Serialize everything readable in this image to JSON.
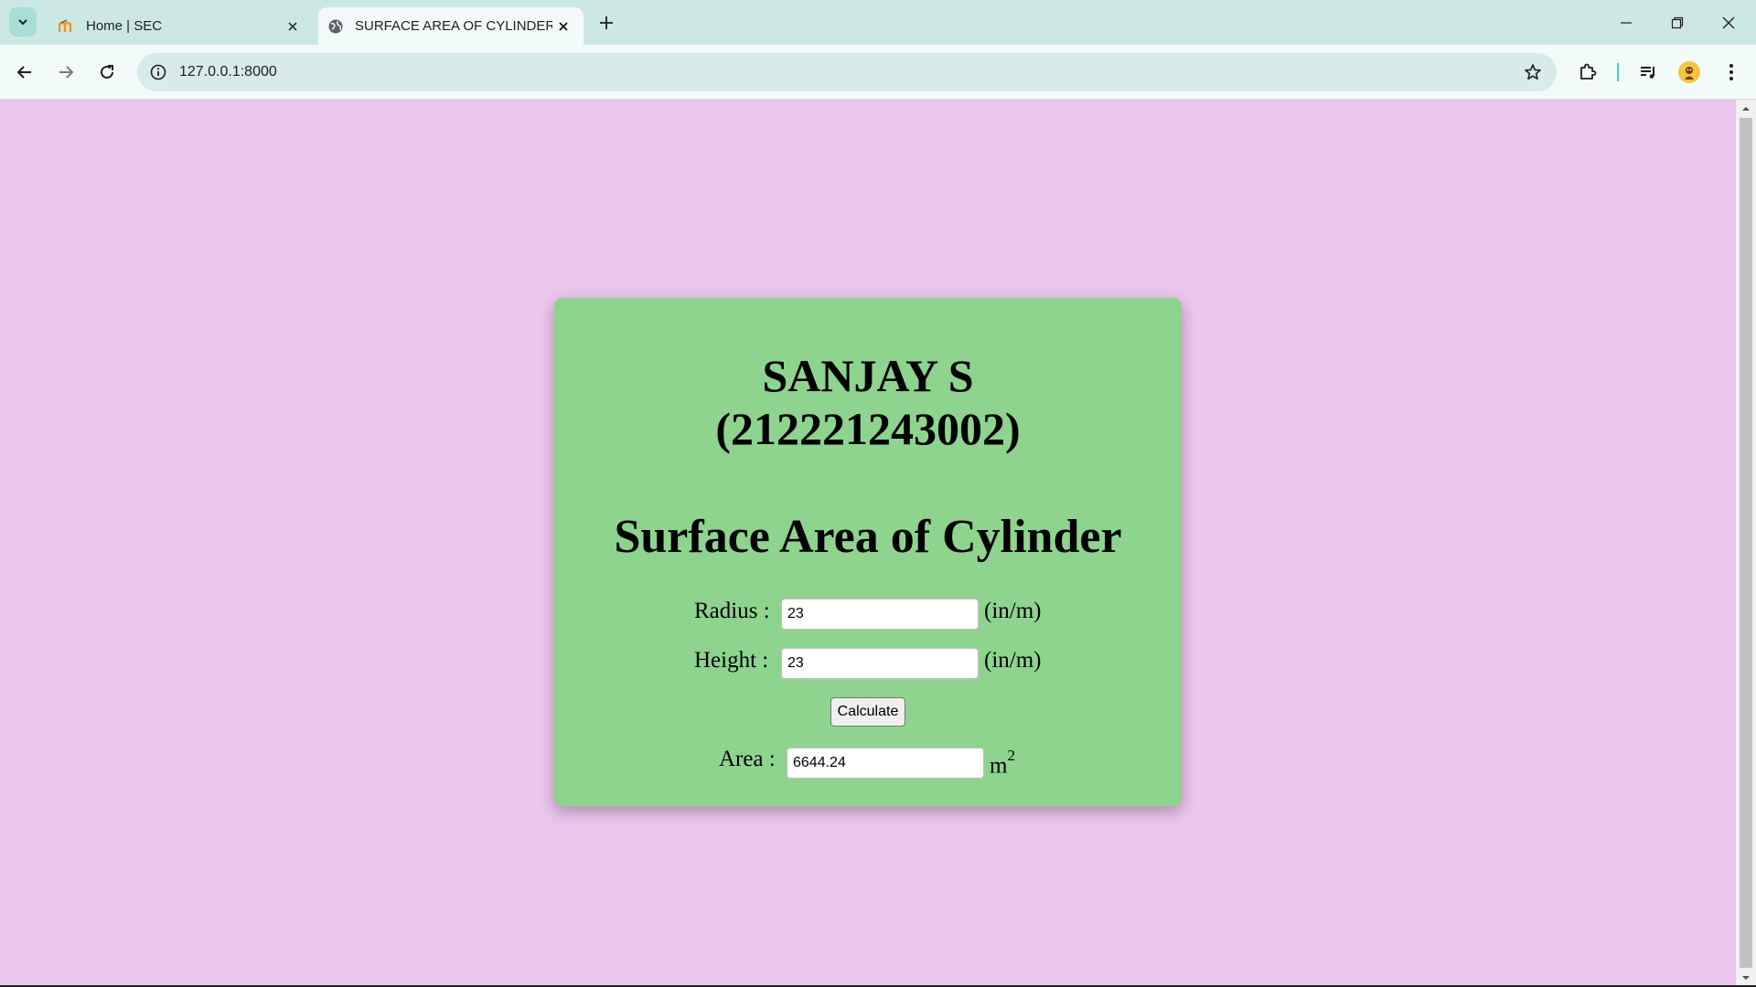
{
  "browser": {
    "tabs": [
      {
        "title": "Home | SEC",
        "active": false,
        "favicon": "moodle-icon"
      },
      {
        "title": "SURFACE AREA OF CYLINDER",
        "active": true,
        "favicon": "globe-icon"
      }
    ],
    "url": "127.0.0.1:8000"
  },
  "page": {
    "name_line": "SANJAY S",
    "id_line": "(212221243002)",
    "title": "Surface Area of Cylinder",
    "radius": {
      "label": "Radius :",
      "value": "23",
      "unit": "(in/m)"
    },
    "height": {
      "label": "Height :",
      "value": "23",
      "unit": "(in/m)"
    },
    "calculate_label": "Calculate",
    "area": {
      "label": "Area :",
      "value": "6644.24",
      "unit": "m",
      "unit_sup": "2"
    }
  },
  "colors": {
    "background": "#eac5ee",
    "card": "#8ed48f",
    "tabstrip": "#cce8e4",
    "toolbar": "#f2fbfa"
  }
}
